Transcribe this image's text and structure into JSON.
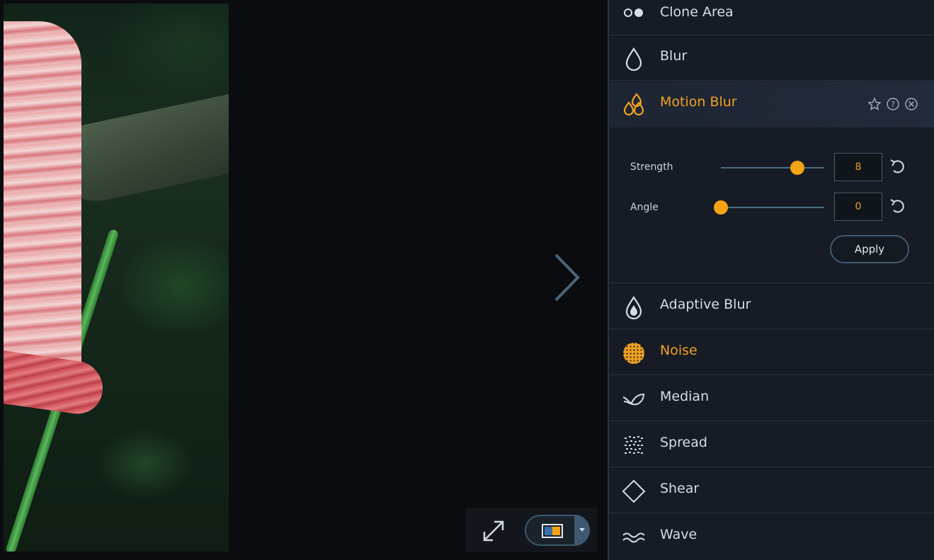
{
  "effects": {
    "clone_area": "Clone Area",
    "blur": "Blur",
    "motion_blur": "Motion Blur",
    "adaptive_blur": "Adaptive Blur",
    "noise": "Noise",
    "median": "Median",
    "spread": "Spread",
    "shear": "Shear",
    "wave": "Wave"
  },
  "motion_blur_settings": {
    "strength_label": "Strength",
    "strength_value": "8",
    "strength_fraction": 0.74,
    "angle_label": "Angle",
    "angle_value": "0",
    "angle_fraction": 0.0,
    "apply_label": "Apply"
  },
  "colors": {
    "accent": "#f0a21f",
    "panel_bg": "#161b25",
    "canvas_bg": "#0b0c10"
  },
  "icons": {
    "clone_area": "clone-circles-icon",
    "blur": "droplet-icon",
    "motion_blur": "three-drops-icon",
    "adaptive_blur": "filled-droplet-icon",
    "noise": "dotted-circle-icon",
    "median": "feather-icon",
    "spread": "dotted-grid-icon",
    "shear": "diamond-icon",
    "wave": "wave-icon"
  }
}
